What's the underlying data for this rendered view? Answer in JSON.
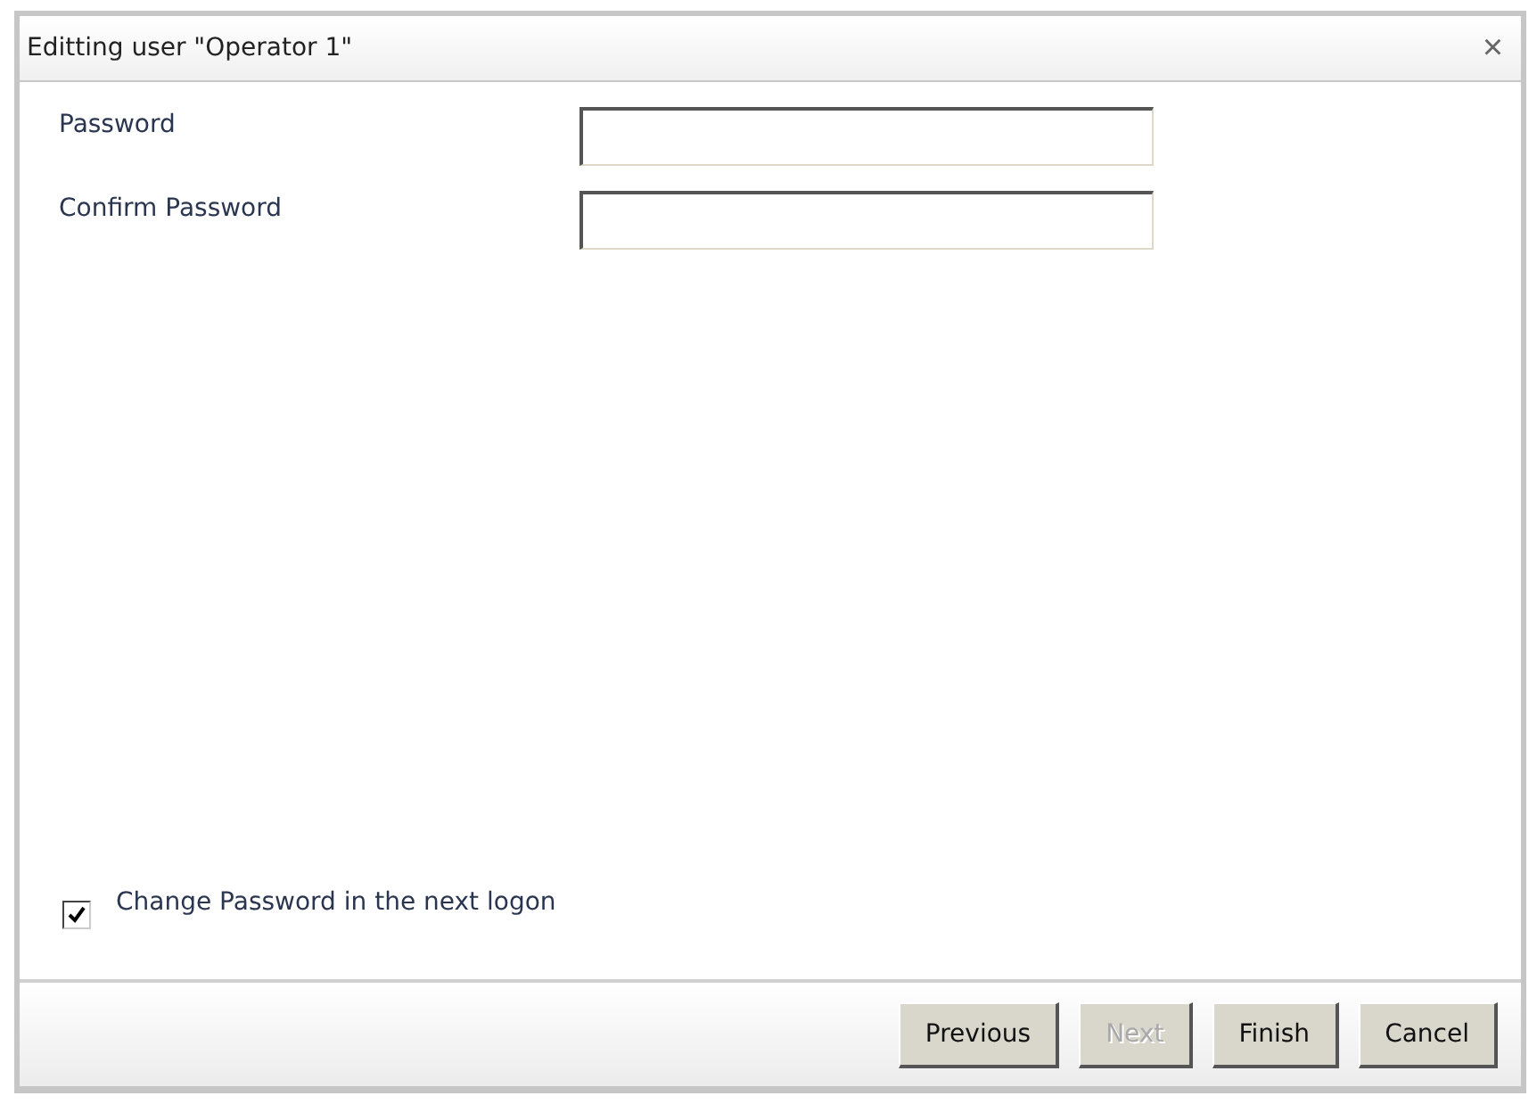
{
  "window": {
    "title": "Editting user \"Operator 1\"",
    "close": "×"
  },
  "fields": [
    {
      "label": "Password"
    },
    {
      "label": "Confirm Password"
    }
  ],
  "options": [
    {
      "label": "Change Password in the next logon",
      "checked": true
    }
  ],
  "buttons": [
    {
      "label": "Previous",
      "disabled": false
    },
    {
      "label": "Next",
      "disabled": true
    },
    {
      "label": "Finish",
      "disabled": false
    },
    {
      "label": "Cancel",
      "disabled": false
    }
  ]
}
